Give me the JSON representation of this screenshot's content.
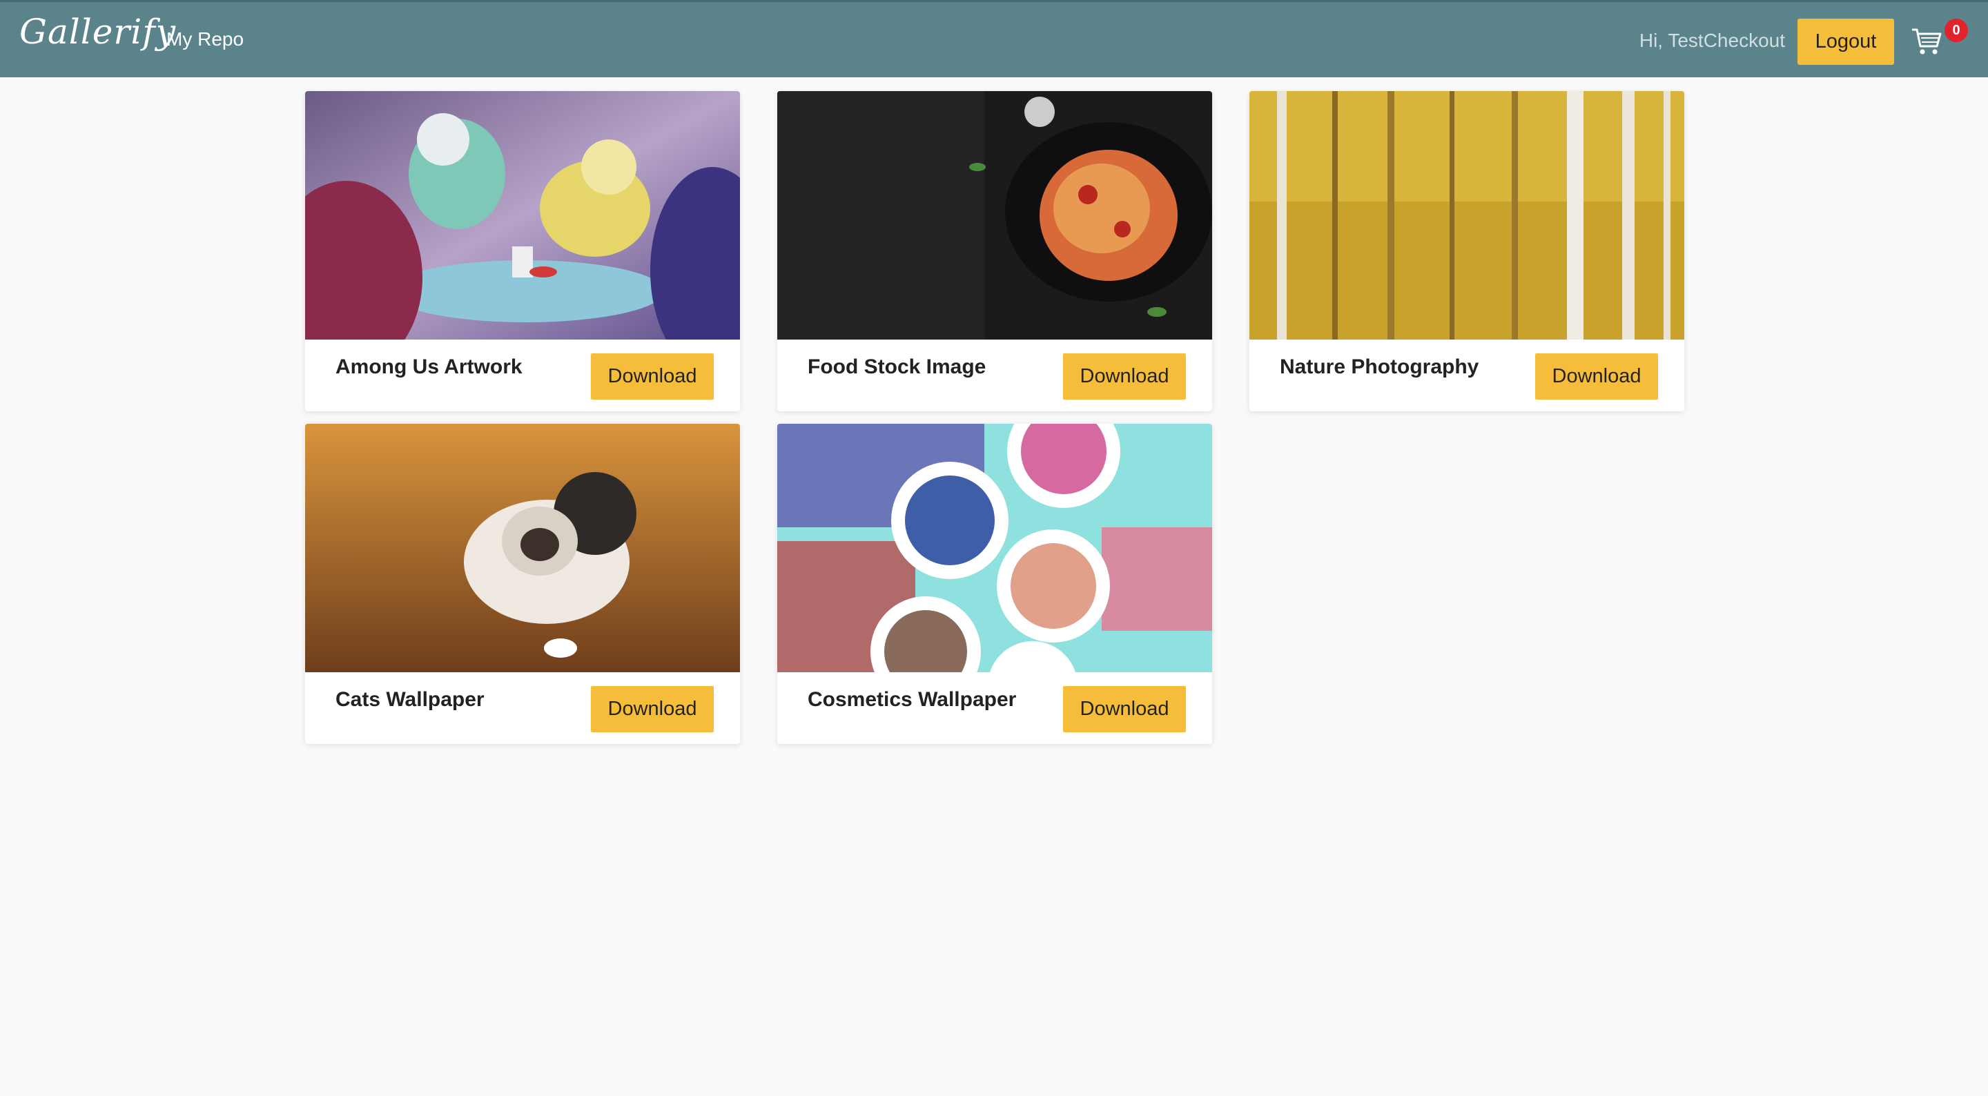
{
  "nav": {
    "brand": "Gallerify",
    "repo_link": "My Repo",
    "greeting": "Hi, TestCheckout",
    "logout_label": "Logout",
    "cart_icon": "cart-icon",
    "cart_count": "0"
  },
  "gallery": {
    "items": [
      {
        "title": "Among Us Artwork",
        "button": "Download"
      },
      {
        "title": "Food Stock Image",
        "button": "Download"
      },
      {
        "title": "Nature Photography",
        "button": "Download"
      },
      {
        "title": "Cats Wallpaper",
        "button": "Download"
      },
      {
        "title": "Cosmetics Wallpaper",
        "button": "Download"
      }
    ]
  },
  "colors": {
    "navbar": "#5b838b",
    "accent": "#f6bd3a",
    "badge": "#e2232b",
    "background": "#f9f9f9"
  }
}
